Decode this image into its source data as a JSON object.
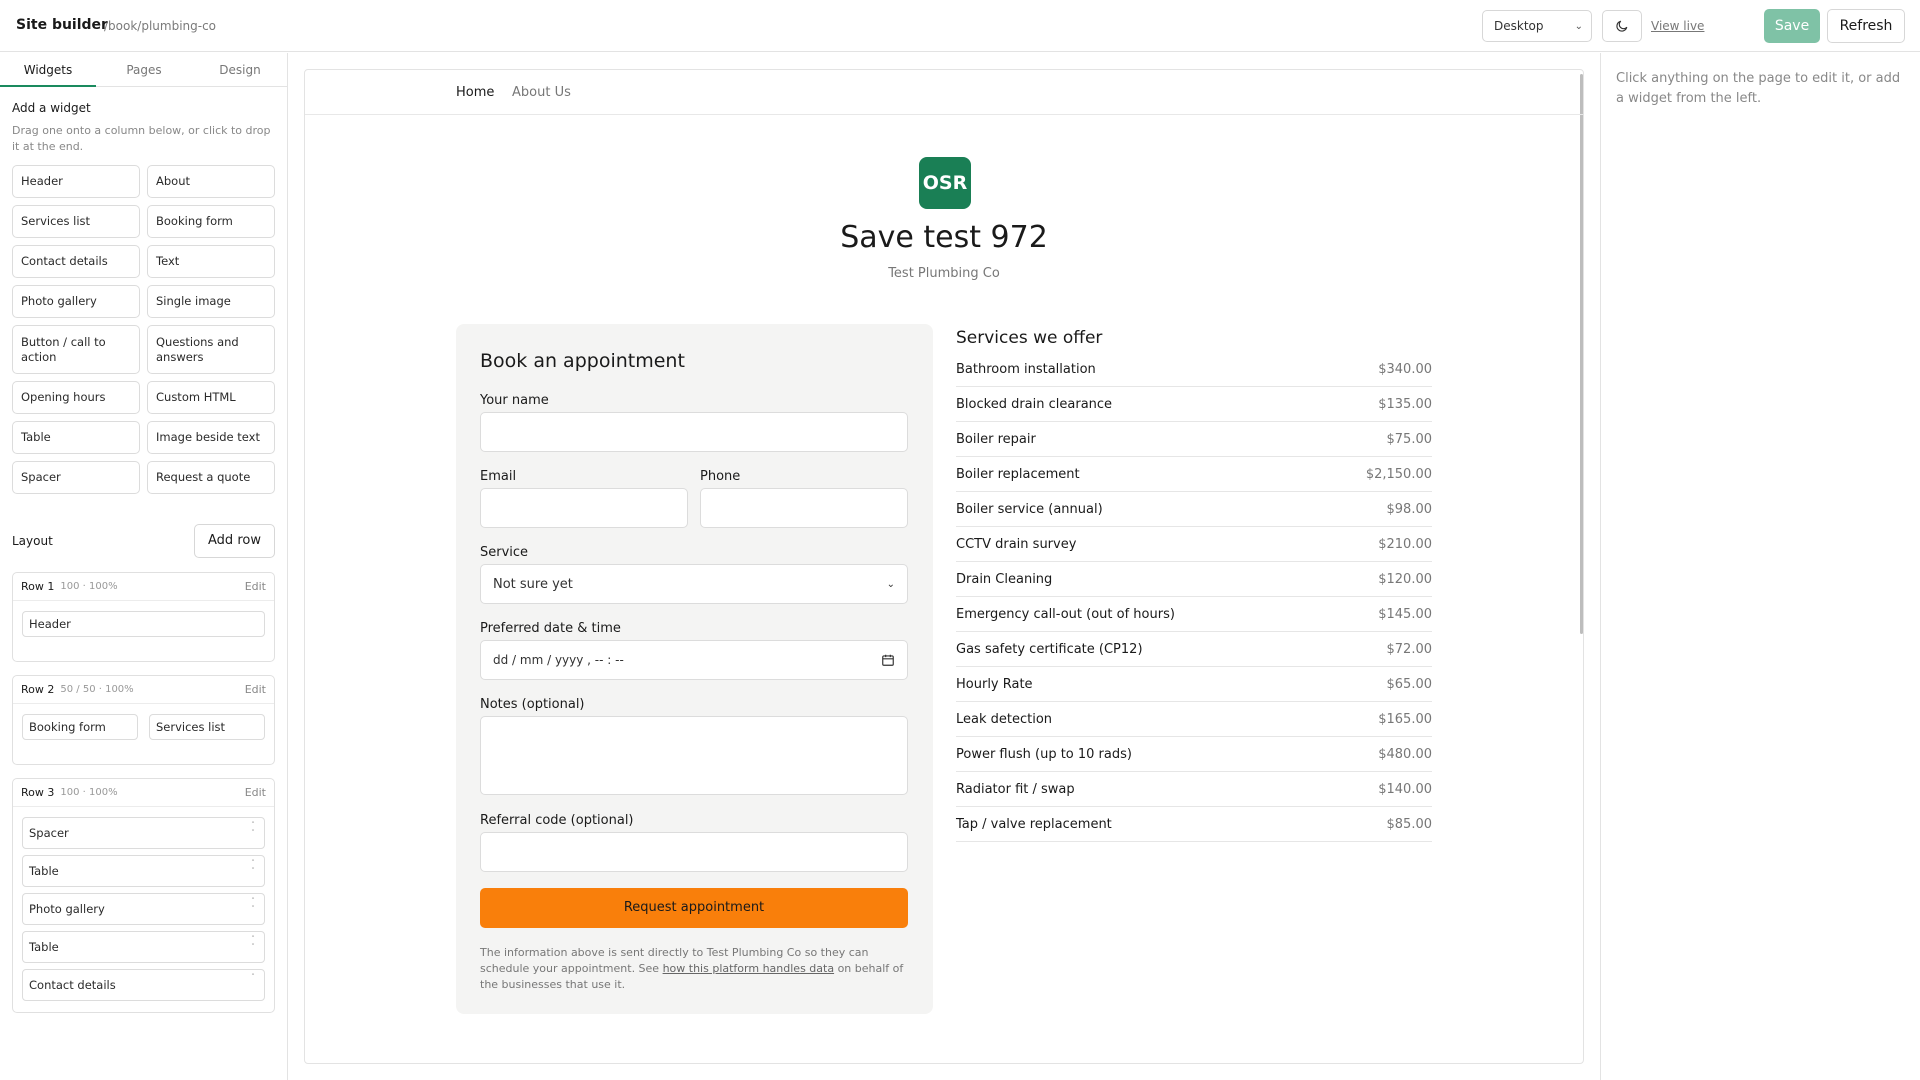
{
  "topbar": {
    "app_title": "Site builder",
    "path": "/book/plumbing-co",
    "device": "Desktop",
    "theme_icon": "moon-icon",
    "view_live": "View live",
    "save": "Save",
    "refresh": "Refresh"
  },
  "sidebar": {
    "tabs": [
      "Widgets",
      "Pages",
      "Design"
    ],
    "add_widget_title": "Add a widget",
    "add_widget_hint": "Drag one onto a column below, or click to drop it at the end.",
    "widgets": [
      "Header",
      "About",
      "Services list",
      "Booking form",
      "Contact details",
      "Text",
      "Photo gallery",
      "Single image",
      "Button / call to action",
      "Questions and answers",
      "Opening hours",
      "Custom HTML",
      "Table",
      "Image beside text",
      "Spacer",
      "Request a quote"
    ],
    "layout_title": "Layout",
    "add_row": "Add row",
    "rows": [
      {
        "name": "Row 1",
        "meta": "100 · 100%",
        "edit": "Edit",
        "items": [
          "Header"
        ]
      },
      {
        "name": "Row 2",
        "meta": "50 / 50 · 100%",
        "edit": "Edit",
        "items": [
          "Booking form",
          "Services list"
        ]
      },
      {
        "name": "Row 3",
        "meta": "100 · 100%",
        "edit": "Edit",
        "items": [
          "Spacer",
          "Table",
          "Photo gallery",
          "Table",
          "Contact details"
        ]
      }
    ]
  },
  "site": {
    "nav": [
      "Home",
      "About Us"
    ],
    "logo_text": "OSR",
    "title": "Save test 972",
    "subtitle": "Test Plumbing Co",
    "brand_color": "#1a7f55",
    "accent_color": "#f97f0b",
    "booking": {
      "title": "Book an appointment",
      "name_label": "Your name",
      "email_label": "Email",
      "phone_label": "Phone",
      "service_label": "Service",
      "service_value": "Not sure yet",
      "datetime_label": "Preferred date & time",
      "datetime_placeholder": "dd / mm / yyyy ,  -- : --",
      "notes_label": "Notes (optional)",
      "referral_label": "Referral code (optional)",
      "submit": "Request appointment",
      "disclaimer_pre": "The information above is sent directly to Test Plumbing Co so they can schedule your appointment. See ",
      "disclaimer_link": "how this platform handles data",
      "disclaimer_post": " on behalf of the businesses that use it."
    },
    "services": {
      "title": "Services we offer",
      "items": [
        {
          "name": "Bathroom installation",
          "price": "$340.00"
        },
        {
          "name": "Blocked drain clearance",
          "price": "$135.00"
        },
        {
          "name": "Boiler repair",
          "price": "$75.00"
        },
        {
          "name": "Boiler replacement",
          "price": "$2,150.00"
        },
        {
          "name": "Boiler service (annual)",
          "price": "$98.00"
        },
        {
          "name": "CCTV drain survey",
          "price": "$210.00"
        },
        {
          "name": "Drain Cleaning",
          "price": "$120.00"
        },
        {
          "name": "Emergency call-out (out of hours)",
          "price": "$145.00"
        },
        {
          "name": "Gas safety certificate (CP12)",
          "price": "$72.00"
        },
        {
          "name": "Hourly Rate",
          "price": "$65.00"
        },
        {
          "name": "Leak detection",
          "price": "$165.00"
        },
        {
          "name": "Power flush (up to 10 rads)",
          "price": "$480.00"
        },
        {
          "name": "Radiator fit / swap",
          "price": "$140.00"
        },
        {
          "name": "Tap / valve replacement",
          "price": "$85.00"
        }
      ]
    }
  },
  "right_panel": {
    "hint": "Click anything on the page to edit it, or add a widget from the left."
  }
}
